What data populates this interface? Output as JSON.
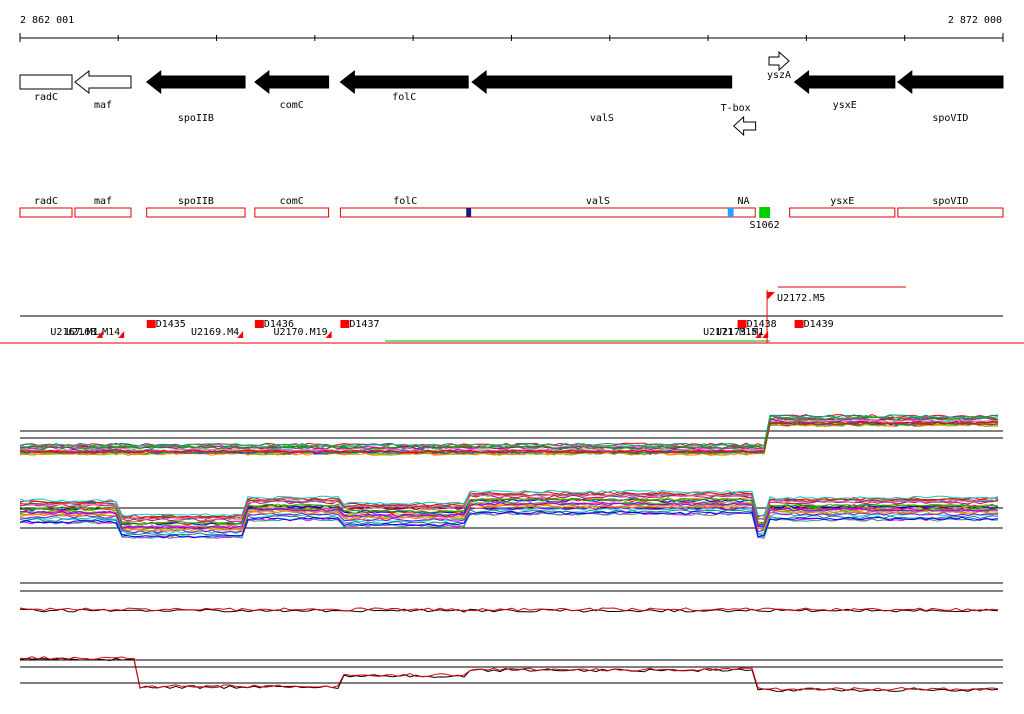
{
  "ruler": {
    "start": 2862001,
    "end": 2872000,
    "start_label": "2 862 001",
    "end_label": "2 872 000",
    "tick_step": 1000
  },
  "colors": {
    "gene_fill": "#000000",
    "gene_outline": "#000000",
    "feature_outline": "#e00000",
    "marker": "#ff0000",
    "green_marker": "#00d000",
    "dark_blue_marker": "#1a1a7a",
    "light_blue_marker": "#2aa0ff",
    "expr_sense": "#000000",
    "expr_antisense": "#e00000"
  },
  "genes": [
    {
      "name": "radC",
      "start": 2862001,
      "end": 2862530,
      "strand": "+",
      "filled": false,
      "label_row": 1
    },
    {
      "name": "maf",
      "start": 2862560,
      "end": 2863130,
      "strand": "-",
      "filled": false,
      "label_row": 2
    },
    {
      "name": "spoIIB",
      "start": 2863290,
      "end": 2864290,
      "strand": "-",
      "filled": true,
      "label_row": 3
    },
    {
      "name": "comC",
      "start": 2864390,
      "end": 2865140,
      "strand": "-",
      "filled": true,
      "label_row": 2
    },
    {
      "name": "folC",
      "start": 2865260,
      "end": 2866560,
      "strand": "-",
      "filled": true,
      "label_row": 1
    },
    {
      "name": "valS",
      "start": 2866600,
      "end": 2869240,
      "strand": "-",
      "filled": true,
      "label_row": 3
    },
    {
      "name": "ysxE",
      "start": 2869880,
      "end": 2870900,
      "strand": "-",
      "filled": true,
      "label_row": 2
    },
    {
      "name": "spoVID",
      "start": 2870930,
      "end": 2872000,
      "strand": "-",
      "filled": true,
      "label_row": 3
    }
  ],
  "small_features": [
    {
      "name": "yszA",
      "start": 2869620,
      "end": 2869820,
      "strand": "+",
      "label_pos": "below"
    },
    {
      "name": "T-box",
      "start": 2869260,
      "end": 2869500,
      "strand": "-",
      "label_pos": "above"
    }
  ],
  "annotations": [
    {
      "name": "radC",
      "start": 2862001,
      "end": 2862530
    },
    {
      "name": "maf",
      "start": 2862560,
      "end": 2863130
    },
    {
      "name": "spoIIB",
      "start": 2863290,
      "end": 2864290
    },
    {
      "name": "comC",
      "start": 2864390,
      "end": 2865140
    },
    {
      "name": "folC",
      "start": 2865260,
      "end": 2869240,
      "label_at": 2865920,
      "second_label": "valS",
      "second_label_at": 2867880
    },
    {
      "name": "NA",
      "start": 2869240,
      "end": 2869480
    },
    {
      "name": "ysxE",
      "start": 2869830,
      "end": 2870900
    },
    {
      "name": "spoVID",
      "start": 2870930,
      "end": 2872000
    }
  ],
  "annotation_marks": [
    {
      "kind": "dark_blue_marker",
      "at": 2866540,
      "width": 50
    },
    {
      "kind": "light_blue_marker",
      "at": 2869200,
      "width": 60
    },
    {
      "kind": "green_marker",
      "at": 2869520,
      "width": 110,
      "label": "S1062"
    }
  ],
  "segments": [
    {
      "label": "U2172.M5",
      "at": 2869600,
      "row": "top"
    },
    {
      "label": "D1435",
      "at": 2863290,
      "row": "mid"
    },
    {
      "label": "D1436",
      "at": 2864390,
      "row": "mid"
    },
    {
      "label": "D1437",
      "at": 2865260,
      "row": "mid"
    },
    {
      "label": "D1438",
      "at": 2869300,
      "row": "mid"
    },
    {
      "label": "D1439",
      "at": 2869880,
      "row": "mid"
    },
    {
      "label": "U2168.M14",
      "at": 2863000,
      "row": "low"
    },
    {
      "label": "U2167.M1",
      "at": 2862780,
      "row": "low"
    },
    {
      "label": "U2169.M4",
      "at": 2864210,
      "row": "low"
    },
    {
      "label": "U2170.M19",
      "at": 2865110,
      "row": "low"
    },
    {
      "label": "U2171.M15",
      "at": 2869480,
      "row": "low"
    },
    {
      "label": "U2173.M1",
      "at": 2869550,
      "row": "low"
    }
  ],
  "expression_profiles": {
    "tracks": [
      {
        "name": "sense",
        "levels": [
          [
            2862001,
            0.28
          ],
          [
            2869450,
            0.28
          ],
          [
            2869620,
            0.8
          ],
          [
            2872000,
            0.55
          ]
        ]
      },
      {
        "name": "antisense",
        "levels": [
          [
            2862001,
            0.45
          ],
          [
            2863000,
            0.2
          ],
          [
            2864290,
            0.5
          ],
          [
            2865260,
            0.4
          ],
          [
            2866560,
            0.6
          ],
          [
            2869450,
            0.2
          ],
          [
            2869620,
            0.5
          ],
          [
            2872000,
            0.45
          ]
        ]
      }
    ],
    "summary": [
      {
        "name": "sense_black",
        "levels": [
          [
            2862001,
            0.4
          ],
          [
            2872000,
            0.35
          ]
        ]
      },
      {
        "name": "anti_black",
        "levels": [
          [
            2862001,
            0.6
          ],
          [
            2863200,
            0.1
          ],
          [
            2865260,
            0.3
          ],
          [
            2866560,
            0.4
          ],
          [
            2869480,
            0.05
          ],
          [
            2872000,
            0.1
          ]
        ]
      }
    ]
  }
}
